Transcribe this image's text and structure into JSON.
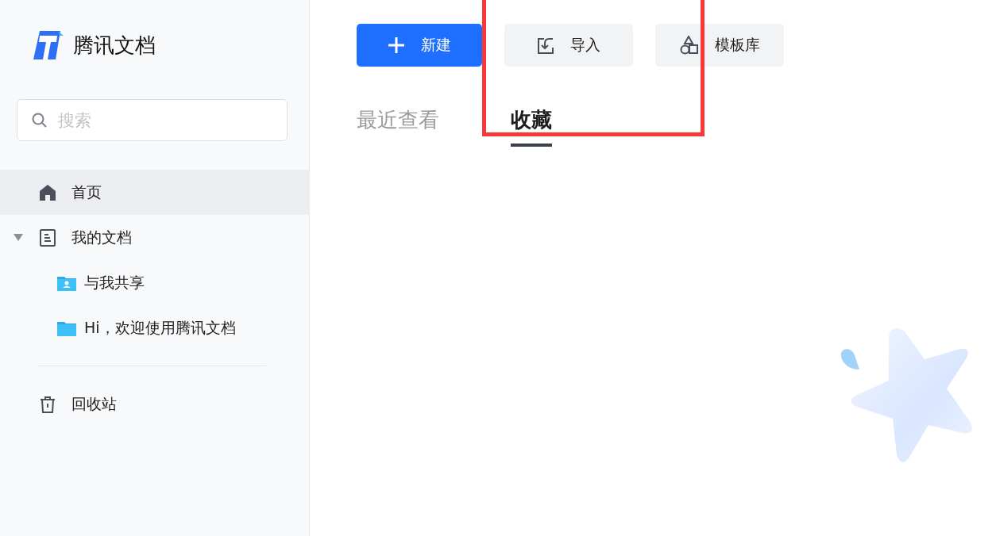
{
  "logo": {
    "text": "腾讯文档"
  },
  "search": {
    "placeholder": "搜索"
  },
  "nav": [
    {
      "kind": "home",
      "label": "首页",
      "selected": true
    },
    {
      "kind": "tree",
      "label": "我的文档",
      "selected": false,
      "expanded": true,
      "children": [
        {
          "kind": "shared",
          "label": "与我共享",
          "selected": false
        },
        {
          "kind": "folder",
          "label": "Hi，欢迎使用腾讯文档",
          "selected": false
        }
      ]
    },
    {
      "kind": "trash",
      "label": "回收站",
      "selected": false
    }
  ],
  "actions": [
    {
      "kind": "primary",
      "label": "新建"
    },
    {
      "kind": "import",
      "label": "导入"
    },
    {
      "kind": "templates",
      "label": "模板库"
    }
  ],
  "tabs": [
    {
      "label": "最近查看",
      "selected": false
    },
    {
      "label": "收藏",
      "selected": true
    }
  ]
}
